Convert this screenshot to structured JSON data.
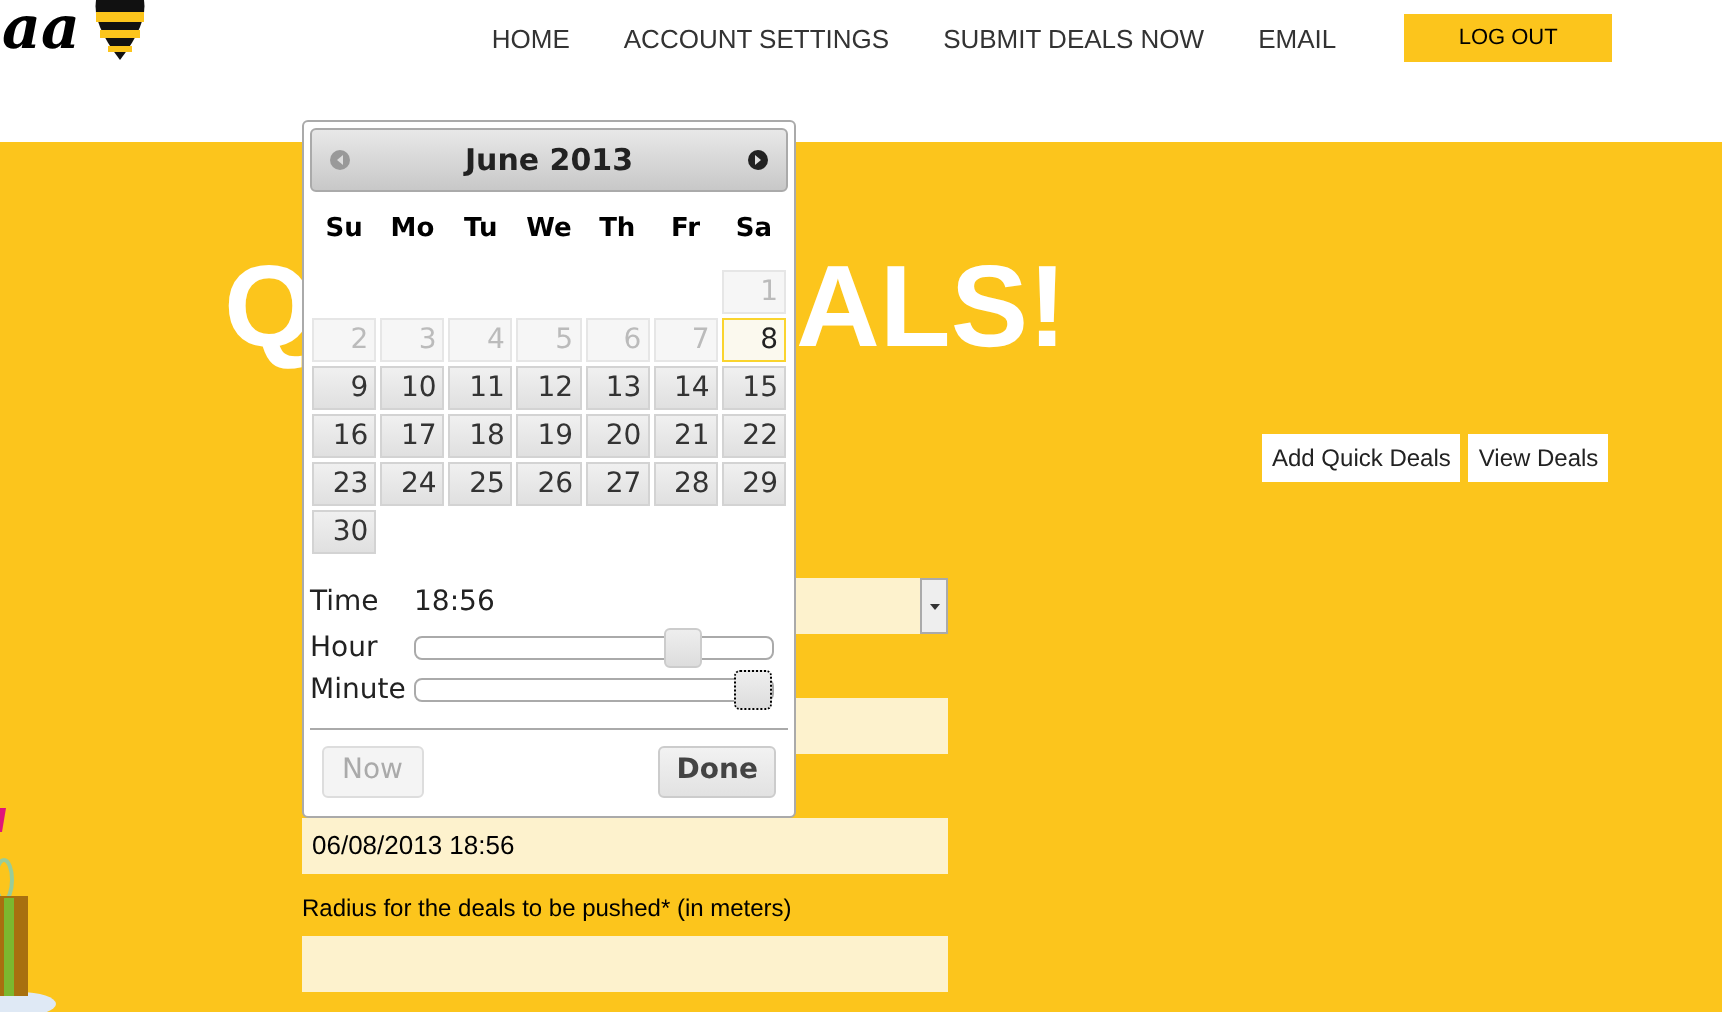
{
  "logo": {
    "text": "aa"
  },
  "nav": [
    {
      "label": "HOME"
    },
    {
      "label": "ACCOUNT SETTINGS"
    },
    {
      "label": "SUBMIT DEALS NOW"
    },
    {
      "label": "EMAIL"
    }
  ],
  "logout_button": "LOG OUT",
  "heading_parts": [
    "Q",
    "ALS!"
  ],
  "actions": [
    "Add Quick Deals",
    "View Deals"
  ],
  "form": {
    "date_value": "06/08/2013 18:56",
    "radius_label": "Radius for the deals to be pushed* (in meters)"
  },
  "datepicker": {
    "title": "June 2013",
    "weekdays": [
      "Su",
      "Mo",
      "Tu",
      "We",
      "Th",
      "Fr",
      "Sa"
    ],
    "weeks": [
      [
        {
          "label": "1",
          "disabled": true,
          "today": false
        }
      ],
      [
        {
          "label": "2",
          "disabled": true,
          "today": false
        },
        {
          "label": "3",
          "disabled": true,
          "today": false
        },
        {
          "label": "4",
          "disabled": true,
          "today": false
        },
        {
          "label": "5",
          "disabled": true,
          "today": false
        },
        {
          "label": "6",
          "disabled": true,
          "today": false
        },
        {
          "label": "7",
          "disabled": true,
          "today": false
        },
        {
          "label": "8",
          "disabled": false,
          "today": true
        }
      ],
      [
        {
          "label": "9",
          "disabled": false,
          "today": false
        },
        {
          "label": "10",
          "disabled": false,
          "today": false
        },
        {
          "label": "11",
          "disabled": false,
          "today": false
        },
        {
          "label": "12",
          "disabled": false,
          "today": false
        },
        {
          "label": "13",
          "disabled": false,
          "today": false
        },
        {
          "label": "14",
          "disabled": false,
          "today": false
        },
        {
          "label": "15",
          "disabled": false,
          "today": false
        }
      ],
      [
        {
          "label": "16",
          "disabled": false,
          "today": false
        },
        {
          "label": "17",
          "disabled": false,
          "today": false
        },
        {
          "label": "18",
          "disabled": false,
          "today": false
        },
        {
          "label": "19",
          "disabled": false,
          "today": false
        },
        {
          "label": "20",
          "disabled": false,
          "today": false
        },
        {
          "label": "21",
          "disabled": false,
          "today": false
        },
        {
          "label": "22",
          "disabled": false,
          "today": false
        }
      ],
      [
        {
          "label": "23",
          "disabled": false,
          "today": false
        },
        {
          "label": "24",
          "disabled": false,
          "today": false
        },
        {
          "label": "25",
          "disabled": false,
          "today": false
        },
        {
          "label": "26",
          "disabled": false,
          "today": false
        },
        {
          "label": "27",
          "disabled": false,
          "today": false
        },
        {
          "label": "28",
          "disabled": false,
          "today": false
        },
        {
          "label": "29",
          "disabled": false,
          "today": false
        }
      ],
      [
        {
          "label": "30",
          "disabled": false,
          "today": false
        }
      ]
    ],
    "time_label": "Time",
    "time_value": "18:56",
    "sliders": [
      {
        "label": "Hour",
        "level": 0.78,
        "focused": false
      },
      {
        "label": "Minute",
        "level": 1.0,
        "focused": true
      }
    ],
    "now_button": {
      "label": "Now",
      "disabled": true
    },
    "done_button": {
      "label": "Done",
      "disabled": false
    }
  }
}
